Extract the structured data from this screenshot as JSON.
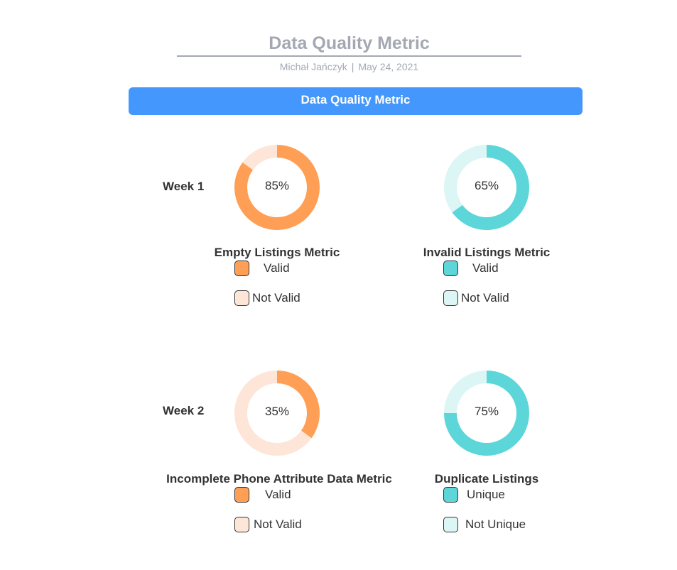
{
  "header": {
    "title": "Data Quality Metric",
    "author": "Michał Jańczyk",
    "separator": "|",
    "date": "May 24, 2021"
  },
  "banner": {
    "label": "Data Quality Metric"
  },
  "weeks": [
    "Week 1",
    "Week 2"
  ],
  "colors": {
    "orange": "#ff9f55",
    "orange_light": "#fde6d8",
    "teal": "#5cd6d9",
    "teal_light": "#dcf5f5",
    "banner": "#4497fd",
    "header_gray": "#a3a8b2"
  },
  "chart_data": [
    {
      "type": "pie",
      "title": "Empty Listings Metric",
      "percent_label": "85%",
      "categories": [
        "Valid",
        "Not Valid"
      ],
      "values": [
        85,
        15
      ],
      "colors": [
        "#ff9f55",
        "#fde6d8"
      ]
    },
    {
      "type": "pie",
      "title": "Invalid Listings Metric",
      "percent_label": "65%",
      "categories": [
        "Valid",
        "Not Valid"
      ],
      "values": [
        65,
        35
      ],
      "colors": [
        "#5cd6d9",
        "#dcf5f5"
      ]
    },
    {
      "type": "pie",
      "title": "Incomplete Phone Attribute Data Metric",
      "percent_label": "35%",
      "categories": [
        "Valid",
        "Not Valid"
      ],
      "values": [
        35,
        65
      ],
      "colors": [
        "#ff9f55",
        "#fde6d8"
      ]
    },
    {
      "type": "pie",
      "title": "Duplicate Listings",
      "percent_label": "75%",
      "categories": [
        "Unique",
        "Not Unique"
      ],
      "values": [
        75,
        25
      ],
      "colors": [
        "#5cd6d9",
        "#dcf5f5"
      ]
    }
  ]
}
